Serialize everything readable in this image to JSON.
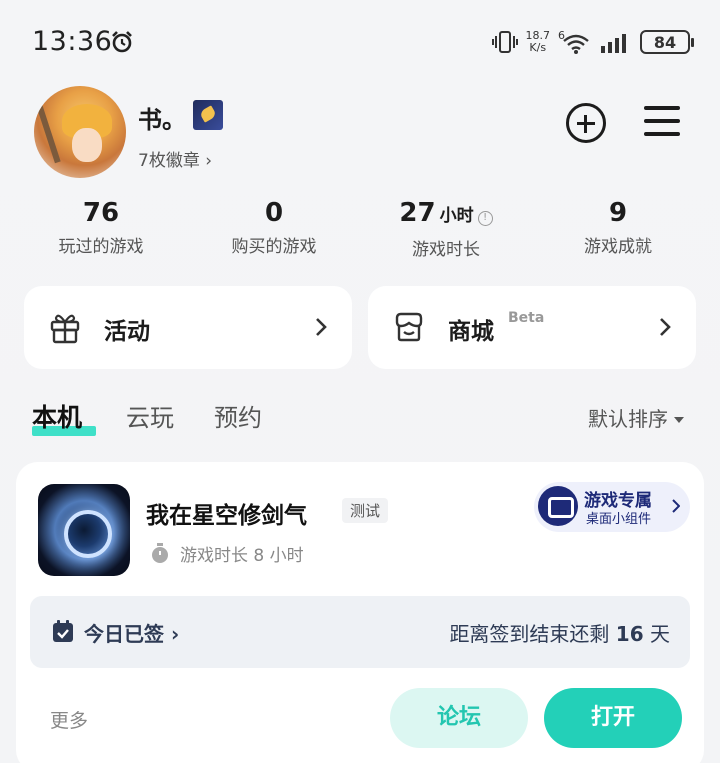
{
  "status_bar": {
    "time": "13:36",
    "net_speed_value": "18.7",
    "net_speed_unit": "K/s",
    "wifi_badge": "6",
    "battery": "84"
  },
  "profile": {
    "username": "书。",
    "badges_link": "7枚徽章 ›"
  },
  "stats": [
    {
      "value": "76",
      "unit": "",
      "label": "玩过的游戏"
    },
    {
      "value": "0",
      "unit": "",
      "label": "购买的游戏"
    },
    {
      "value": "27",
      "unit": "小时",
      "label": "游戏时长"
    },
    {
      "value": "9",
      "unit": "",
      "label": "游戏成就"
    }
  ],
  "cards": {
    "activity": "活动",
    "store": "商城",
    "store_beta": "Beta"
  },
  "tabs": {
    "local": "本机",
    "cloud": "云玩",
    "reserve": "预约",
    "sort": "默认排序"
  },
  "game": {
    "title": "我在星空修剑气",
    "tag": "测试",
    "widget_line1": "游戏专属",
    "widget_line2": "桌面小组件",
    "playtime": "游戏时长 8 小时",
    "signed": "今日已签 ›",
    "remain_prefix": "距离签到结束还剩 ",
    "remain_days": "16",
    "remain_suffix": " 天",
    "more": "更多",
    "forum": "论坛",
    "open": "打开"
  },
  "colors": {
    "accent": "#23d0b8",
    "tab_underline": "#3fe0c8",
    "widget_navy": "#1e2a78"
  },
  "icons": [
    "alarm-icon",
    "vibrate-icon",
    "wifi-icon",
    "signal-icon",
    "battery-icon",
    "plus-circle-icon",
    "menu-icon",
    "gift-icon",
    "store-icon",
    "chevron-right-icon",
    "timer-icon",
    "calendar-check-icon",
    "gamepad-icon"
  ]
}
